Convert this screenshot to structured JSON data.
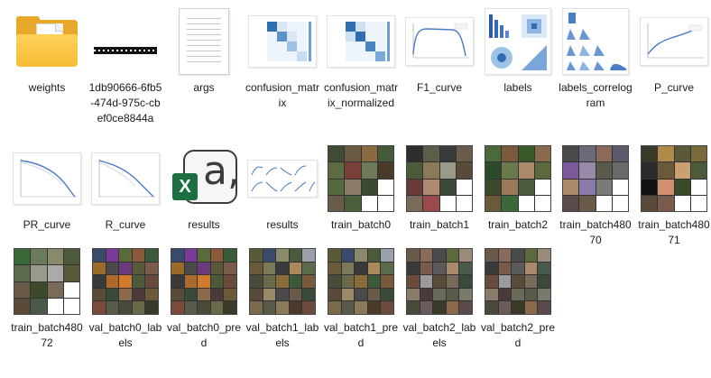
{
  "files": [
    {
      "id": "weights",
      "label": "weights",
      "kind": "folder"
    },
    {
      "id": "hash",
      "label": "1db90666-6fb5-474d-975c-cbef0ce8844a",
      "kind": "blackbar"
    },
    {
      "id": "args",
      "label": "args",
      "kind": "doc"
    },
    {
      "id": "confusion_matrix",
      "label": "confusion_matrix",
      "kind": "matrix"
    },
    {
      "id": "confusion_matrix_normalized",
      "label": "confusion_matrix_normalized",
      "kind": "matrix"
    },
    {
      "id": "F1_curve",
      "label": "F1_curve",
      "kind": "curve"
    },
    {
      "id": "labels",
      "label": "labels",
      "kind": "labels"
    },
    {
      "id": "labels_correlogram",
      "label": "labels_correlogram",
      "kind": "correlogram"
    },
    {
      "id": "P_curve",
      "label": "P_curve",
      "kind": "curve"
    },
    {
      "id": "PR_curve",
      "label": "PR_curve",
      "kind": "curve"
    },
    {
      "id": "R_curve",
      "label": "R_curve",
      "kind": "curve"
    },
    {
      "id": "results_csv",
      "label": "results",
      "kind": "excel"
    },
    {
      "id": "results_png",
      "label": "results",
      "kind": "results"
    },
    {
      "id": "train_batch0",
      "label": "train_batch0",
      "kind": "mosaic"
    },
    {
      "id": "train_batch1",
      "label": "train_batch1",
      "kind": "mosaic"
    },
    {
      "id": "train_batch2",
      "label": "train_batch2",
      "kind": "mosaic"
    },
    {
      "id": "train_batch48070",
      "label": "train_batch48070",
      "kind": "mosaic"
    },
    {
      "id": "train_batch48071",
      "label": "train_batch48071",
      "kind": "mosaic"
    },
    {
      "id": "train_batch48072",
      "label": "train_batch48072",
      "kind": "mosaic"
    },
    {
      "id": "val_batch0_labels",
      "label": "val_batch0_labels",
      "kind": "mosaic"
    },
    {
      "id": "val_batch0_pred",
      "label": "val_batch0_pred",
      "kind": "mosaic"
    },
    {
      "id": "val_batch1_labels",
      "label": "val_batch1_labels",
      "kind": "mosaic"
    },
    {
      "id": "val_batch1_pred",
      "label": "val_batch1_pred",
      "kind": "mosaic"
    },
    {
      "id": "val_batch2_labels",
      "label": "val_batch2_labels",
      "kind": "mosaic"
    },
    {
      "id": "val_batch2_pred",
      "label": "val_batch2_pred",
      "kind": "mosaic"
    }
  ],
  "colors": {
    "folder": "#f5bc36",
    "excel": "#1d6f42",
    "plot_line": "#4a7cc7",
    "matrix_dark": "#2f6fb0"
  }
}
